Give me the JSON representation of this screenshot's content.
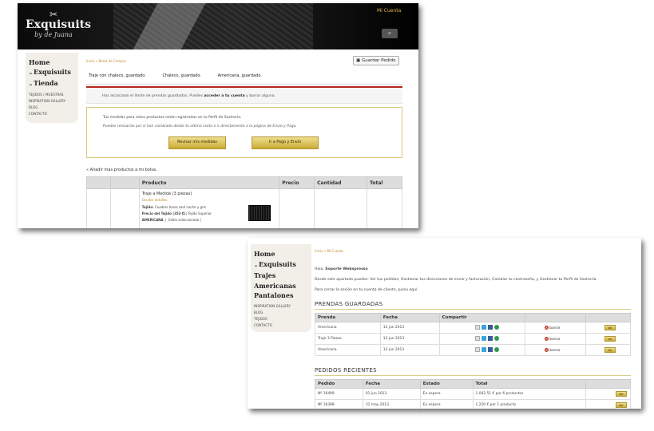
{
  "colors": {
    "accent_gold": "#c9ab35",
    "alert_red": "#b3261e",
    "link_gold": "#c08a2f"
  },
  "header": {
    "brand": "Exquisuits",
    "brand_sub": "by de Juana",
    "my_account": "Mi Cuenta",
    "search_icon": "search-icon"
  },
  "sidebar1": {
    "big": [
      {
        "label": "Home",
        "chev": false
      },
      {
        "label": "Exquisuits",
        "chev": true
      },
      {
        "label": "Tienda",
        "chev": true
      }
    ],
    "small": [
      "TEJIDOS / MUESTRAS",
      "INSPIRATION GALLERY",
      "BLOG",
      "CONTACTO"
    ]
  },
  "cart": {
    "breadcrumb": "Inicio » Bolsa de Compra",
    "save_button": "Guardar Pedido",
    "tabs": [
      "Traje con chaleco, guardado.",
      "Chaleco, guardado.",
      "Americana, guardado."
    ],
    "alert_pre": "Has alcanzado el límite de prendas guardadas. Puedes ",
    "alert_link": "acceder a tu cuenta",
    "alert_post": " y borrar alguna.",
    "info_line1": "Tus medidas para estos productos están registradas en tu Perfil de Sastrería.",
    "info_line2": "Puedes revisarlas por si han cambiado desde tu último visita o ir directamente a la página de Envío y Pago.",
    "btn_review": "Revisar mis medidas",
    "btn_pay": "Ir a Pago y Envío",
    "add_more": "« Añadir más productos a mi bolsa.",
    "columns": [
      "Producto",
      "Precio",
      "Cantidad",
      "Total"
    ],
    "product": {
      "name": "Traje a Medida (3 piezas)",
      "hide_details": "Ocultar detalles",
      "fabric_label": "Tejido:",
      "fabric_value": "Cuadros tonos azul noche y gris",
      "price_label": "Precio del Tejido (353 €):",
      "price_value": "Tejido Superior",
      "jacket_label": "AMERICANA",
      "jacket_value": "Estilo seleccionado |"
    }
  },
  "sidebar2": {
    "big": [
      {
        "label": "Home",
        "chev": false
      },
      {
        "label": "Exquisuits",
        "chev": true
      },
      {
        "label": "Trajes",
        "chev": false
      },
      {
        "label": "Americanas",
        "chev": false
      },
      {
        "label": "Pantalones",
        "chev": false
      }
    ],
    "small": [
      "INSPIRATION GALLERY",
      "BLOG",
      "TEJIDOS",
      "CONTACTO"
    ]
  },
  "account": {
    "breadcrumb": "Inicio » Mi Cuenta",
    "hello_pre": "Hola, ",
    "hello_name": "Soporte Webspresso",
    "intro": "Desde este apartado puedes: Ver tus pedidos; Gestionar tus direcciones de envío y facturación; Cambiar tu contraseña, y Gestionar tu Perfil de Sastrería.",
    "logout": "Para cerrar la sesión en tu cuenta de cliente, pulsa aquí",
    "saved_title": "PRENDAS GUARDADAS",
    "saved_columns": [
      "Prenda",
      "Fecha",
      "Compartir",
      "",
      ""
    ],
    "saved_rows": [
      {
        "item": "Americana",
        "date": "12 jun 2013",
        "delete": "borrar",
        "view": "Ver"
      },
      {
        "item": "Traje 3 Piezas",
        "date": "12 jun 2013",
        "delete": "borrar",
        "view": "Ver"
      },
      {
        "item": "Americana",
        "date": "12 jun 2013",
        "delete": "borrar",
        "view": "Ver"
      }
    ],
    "orders_title": "PEDIDOS RECIENTES",
    "orders_columns": [
      "Pedido",
      "Fecha",
      "Estado",
      "Total",
      ""
    ],
    "orders_rows": [
      {
        "order": "Nº 16499",
        "date": "01 jun 2013",
        "status": "En espera",
        "total": "1.042,51 € por 6 productos",
        "view": "Ver"
      },
      {
        "order": "Nº 16398",
        "date": "31 may 2013",
        "status": "En espera",
        "total": "1.220 € por 1 producto",
        "view": "Ver"
      }
    ]
  }
}
